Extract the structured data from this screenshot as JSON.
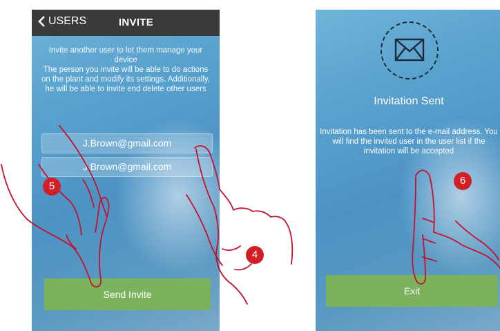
{
  "left_screen": {
    "back_label": "USERS",
    "title": "INVITE",
    "description": "Invite another user to let them manage your device\nThe person you invite will be able to do actions on the plant and modify its settings. Additionally, he will be able to invite end delete other users",
    "email_field_1": "J.Brown@gmail.com",
    "email_field_2": "J.Brown@gmail.com",
    "send_button_label": "Send Invite"
  },
  "right_screen": {
    "icon": "envelope-icon",
    "title": "Invitation Sent",
    "description": "Invitation has been sent to the e-mail address. You will find the invited user in the user list if the invitation will be accepted",
    "exit_button_label": "Exit"
  },
  "step_badges": {
    "step_5": "5",
    "step_4": "4",
    "step_6": "6"
  },
  "colors": {
    "topbar": "#3a3a3a",
    "button_green": "#7bb25d",
    "badge_red": "#d21f26",
    "hand_outline": "#c8102e"
  }
}
